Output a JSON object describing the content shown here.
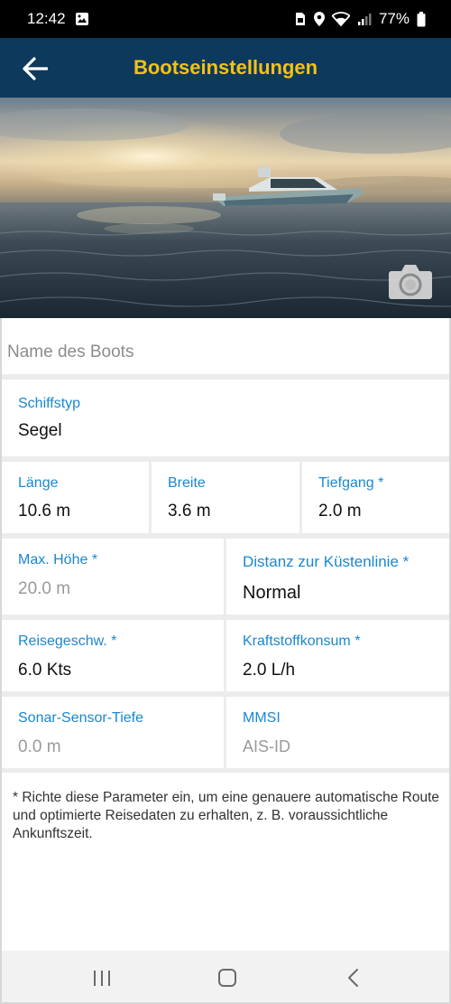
{
  "status_bar": {
    "time": "12:42",
    "battery": "77%"
  },
  "header": {
    "title": "Bootseinstellungen"
  },
  "icons": {
    "back": "arrow-left-icon",
    "camera": "camera-icon",
    "gallery": "image-icon",
    "wifi": "wifi-icon",
    "signal": "signal-icon",
    "battery": "battery-icon",
    "location": "location-pin-icon"
  },
  "colors": {
    "header_bg": "#0d3a5c",
    "title": "#f5c114",
    "label": "#1a87d0"
  },
  "form": {
    "boat_name": {
      "placeholder": "Name des Boots",
      "value": ""
    },
    "ship_type": {
      "label": "Schiffstyp",
      "value": "Segel"
    },
    "length": {
      "label": "Länge",
      "value": "10.6 m"
    },
    "width": {
      "label": "Breite",
      "value": "3.6 m"
    },
    "draft": {
      "label": "Tiefgang *",
      "value": "2.0 m"
    },
    "max_height": {
      "label": "Max. Höhe *",
      "value": "20.0 m"
    },
    "shore_distance": {
      "label": "Distanz zur Küstenlinie *",
      "value": "Normal"
    },
    "cruise_speed": {
      "label": "Reisegeschw. *",
      "value": "6.0 Kts"
    },
    "fuel_consumption": {
      "label": "Kraftstoffkonsum *",
      "value": "2.0 L/h"
    },
    "sonar_depth": {
      "label": "Sonar-Sensor-Tiefe",
      "value": "0.0 m"
    },
    "mmsi": {
      "label": "MMSI",
      "value": "AIS-ID"
    }
  },
  "footnote": "* Richte diese Parameter ein, um eine genauere automatische Route und optimierte Reisedaten zu erhalten, z. B. voraussichtliche Ankunftszeit."
}
